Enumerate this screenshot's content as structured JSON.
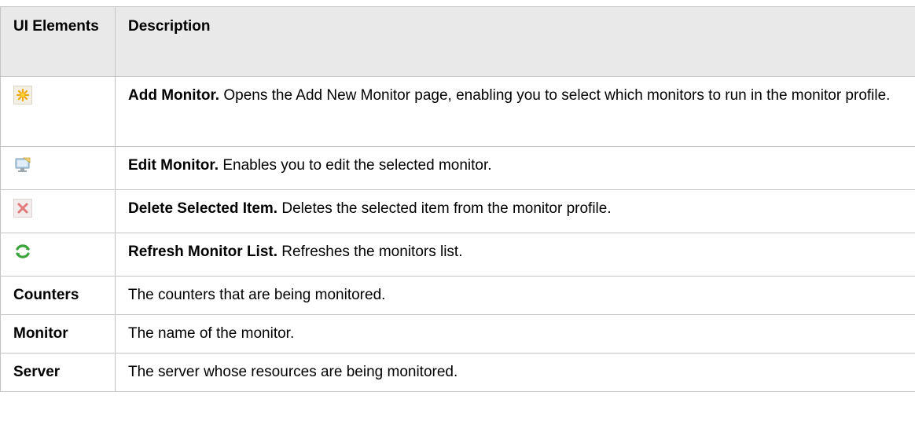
{
  "table": {
    "header": {
      "col1": "UI Elements",
      "col2": "Description"
    },
    "rows": [
      {
        "icon": "add-monitor-icon",
        "term": "Add Monitor.",
        "text": " Opens the Add New Monitor page, enabling you to select which monitors to run in the monitor profile."
      },
      {
        "icon": "edit-monitor-icon",
        "term": "Edit Monitor.",
        "text": " Enables you to edit the selected monitor."
      },
      {
        "icon": "delete-item-icon",
        "term": "Delete Selected Item.",
        "text": " Deletes the selected item from the monitor profile."
      },
      {
        "icon": "refresh-icon",
        "term": "Refresh Monitor List.",
        "text": " Refreshes the monitors list."
      },
      {
        "label": "Counters",
        "text": "The counters that are being monitored."
      },
      {
        "label": "Monitor",
        "text": "The name of the monitor."
      },
      {
        "label": "Server",
        "text": "The server whose resources are being monitored."
      }
    ]
  }
}
